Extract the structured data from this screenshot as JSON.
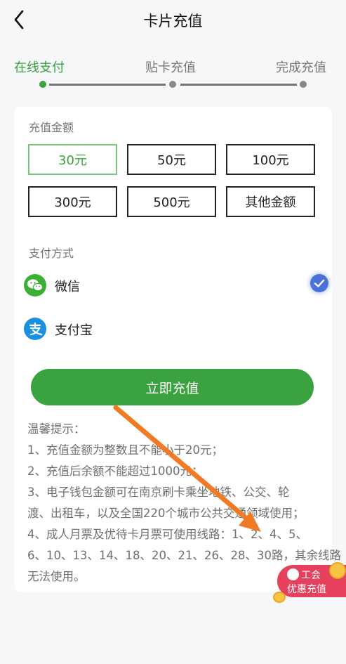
{
  "header": {
    "title": "卡片充值",
    "back_icon": "chevron-left-icon"
  },
  "steps": [
    {
      "label": "在线支付",
      "active": true
    },
    {
      "label": "贴卡充值",
      "active": false
    },
    {
      "label": "完成充值",
      "active": false
    }
  ],
  "amount_section": {
    "title": "充值金额",
    "options": [
      "30元",
      "50元",
      "100元",
      "300元",
      "500元",
      "其他金额"
    ],
    "selected": "30元"
  },
  "payment_section": {
    "title": "支付方式",
    "methods": [
      {
        "label": "微信",
        "icon": "wechat-pay-icon",
        "selected": true
      },
      {
        "label": "支付宝",
        "icon": "alipay-icon",
        "selected": false
      }
    ]
  },
  "cta": {
    "label": "立即充值"
  },
  "tips": {
    "title": "温馨提示：",
    "lines": [
      "1、充值金额为整数且不能小于20元；",
      "2、充值后余额不能超过1000元；",
      "3、电子钱包金额可在南京刷卡乘坐地铁、公交、轮",
      "渡、出租车，以及全国220个城市公共交通领域使用；",
      "4、成人月票及优待卡月票可使用线路：1、2、4、5、",
      "6、10、13、14、18、20、21、26、28、30路，其余线路",
      "无法使用。"
    ]
  },
  "promo": {
    "line1": "工会",
    "line2": "优惠充值"
  },
  "colors": {
    "accent": "#3aa23e",
    "check": "#4a72d8",
    "promo": "#e5415d",
    "arrow": "#f37a24"
  }
}
